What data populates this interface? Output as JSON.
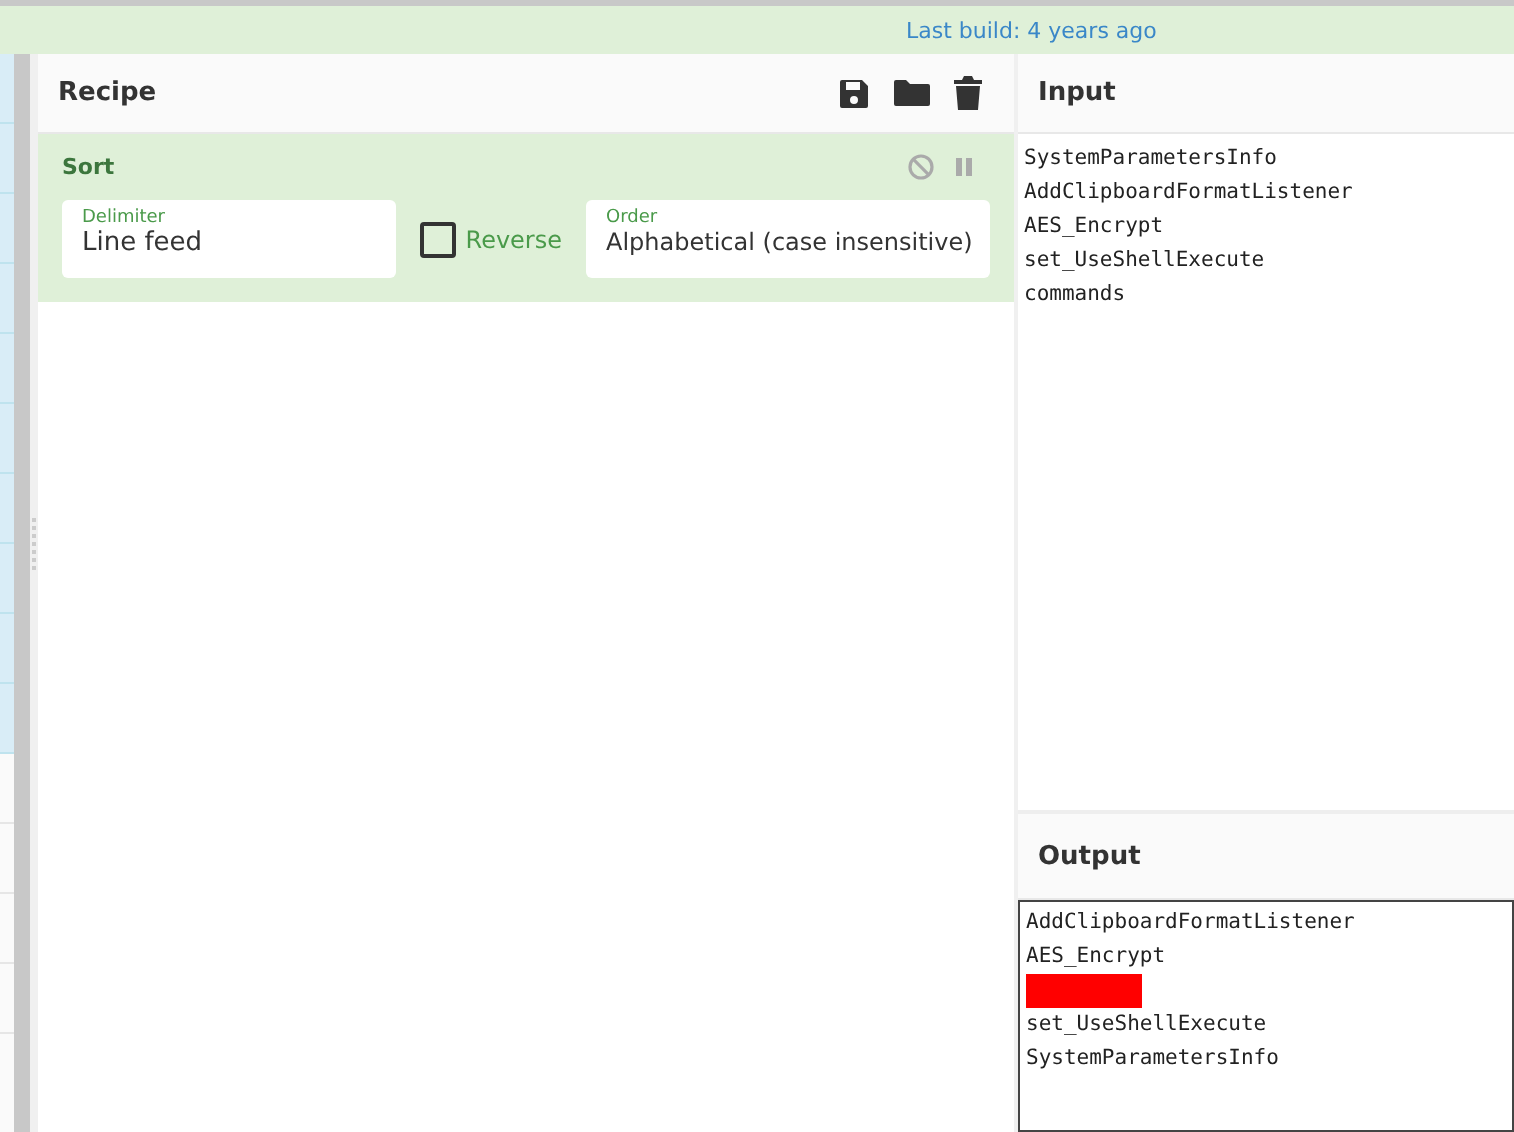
{
  "top_bar": {
    "build_notice": "Last build: 4 years ago"
  },
  "recipe": {
    "title": "Recipe",
    "operations": [
      {
        "name": "Sort",
        "disabled": false,
        "paused": false,
        "delimiter": {
          "label": "Delimiter",
          "value": "Line feed"
        },
        "reverse": {
          "label": "Reverse",
          "checked": false
        },
        "order": {
          "label": "Order",
          "value": "Alphabetical (case insensitive)"
        }
      }
    ]
  },
  "input": {
    "title": "Input",
    "lines": [
      "SystemParametersInfo",
      "AddClipboardFormatListener",
      "AES_Encrypt",
      "set_UseShellExecute",
      "commands"
    ]
  },
  "output": {
    "title": "Output",
    "lines": [
      {
        "kind": "text",
        "text": "AddClipboardFormatListener"
      },
      {
        "kind": "text",
        "text": "AES_Encrypt"
      },
      {
        "kind": "redacted"
      },
      {
        "kind": "text",
        "text": "set_UseShellExecute"
      },
      {
        "kind": "text",
        "text": "SystemParametersInfo"
      }
    ]
  }
}
